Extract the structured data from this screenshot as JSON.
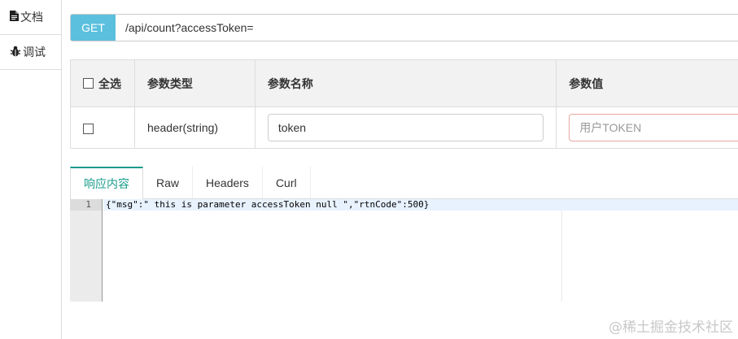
{
  "sidebar": {
    "items": [
      {
        "label": "文档",
        "icon": "document-icon"
      },
      {
        "label": "调试",
        "icon": "bug-icon"
      }
    ]
  },
  "request": {
    "method": "GET",
    "url": "/api/count?accessToken="
  },
  "params": {
    "headers": [
      "全选",
      "参数类型",
      "参数名称",
      "参数值"
    ],
    "rows": [
      {
        "type": "header(string)",
        "name": "token",
        "value": "",
        "value_placeholder": "用户TOKEN"
      }
    ]
  },
  "response": {
    "tabs": [
      "响应内容",
      "Raw",
      "Headers",
      "Curl"
    ],
    "active_tab": "响应内容",
    "line_number": "1",
    "body": "{\"msg\":\" this is parameter accessToken null \",\"rtnCode\":500}"
  },
  "watermark": "@稀土掘金技术社区",
  "colors": {
    "method_bg": "#5bc0de",
    "active_tab": "#1a9c8c",
    "error_border": "#e8a7a0"
  }
}
